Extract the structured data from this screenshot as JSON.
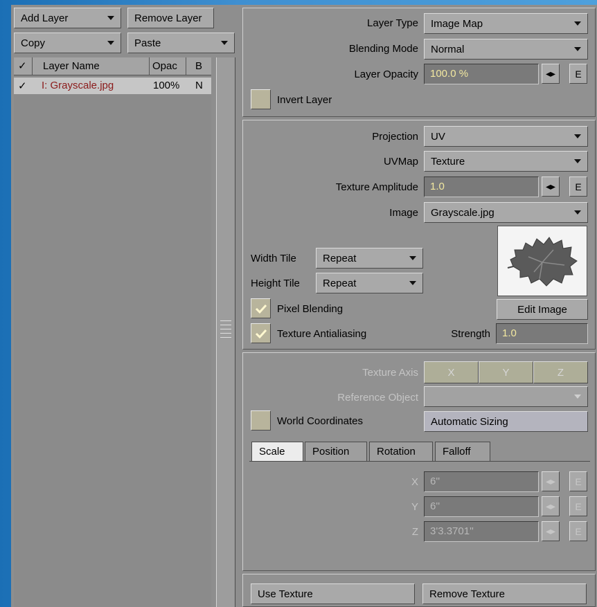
{
  "left_panel": {
    "add_layer": "Add Layer",
    "remove_layer": "Remove Layer",
    "copy": "Copy",
    "paste": "Paste",
    "columns": {
      "check": "✓",
      "name": "Layer Name",
      "opac": "Opac",
      "blend": "B"
    },
    "rows": [
      {
        "check": "✓",
        "name": "I: Grayscale.jpg",
        "opac": "100%",
        "blend": "N"
      }
    ]
  },
  "layer_section": {
    "layer_type_label": "Layer Type",
    "layer_type_value": "Image Map",
    "blending_mode_label": "Blending Mode",
    "blending_mode_value": "Normal",
    "layer_opacity_label": "Layer Opacity",
    "layer_opacity_value": "100.0 %",
    "envelope_label": "E",
    "invert_layer_label": "Invert Layer",
    "invert_layer_checked": false
  },
  "projection_section": {
    "projection_label": "Projection",
    "projection_value": "UV",
    "uvmap_label": "UVMap",
    "uvmap_value": "Texture",
    "texture_amplitude_label": "Texture Amplitude",
    "texture_amplitude_value": "1.0",
    "envelope_label": "E",
    "image_label": "Image",
    "image_value": "Grayscale.jpg",
    "width_tile_label": "Width Tile",
    "width_tile_value": "Repeat",
    "height_tile_label": "Height Tile",
    "height_tile_value": "Repeat",
    "pixel_blending_label": "Pixel Blending",
    "pixel_blending_checked": true,
    "texture_antialiasing_label": "Texture Antialiasing",
    "texture_antialiasing_checked": true,
    "edit_image_label": "Edit Image",
    "strength_label": "Strength",
    "strength_value": "1.0"
  },
  "axis_section": {
    "texture_axis_label": "Texture Axis",
    "axis_x": "X",
    "axis_y": "Y",
    "axis_z": "Z",
    "reference_object_label": "Reference Object",
    "reference_object_value": "",
    "world_coordinates_label": "World Coordinates",
    "world_coordinates_checked": false,
    "automatic_sizing_label": "Automatic Sizing",
    "tabs": [
      "Scale",
      "Position",
      "Rotation",
      "Falloff"
    ],
    "active_tab": "Scale",
    "scale": [
      {
        "axis": "X",
        "value": "6''"
      },
      {
        "axis": "Y",
        "value": "6''"
      },
      {
        "axis": "Z",
        "value": "3'3.3701''"
      }
    ],
    "envelope_label": "E"
  },
  "footer": {
    "use_texture": "Use Texture",
    "remove_texture": "Remove Texture"
  },
  "colors": {
    "panel": "#8e8e8e",
    "field_text": "#f2e8a0",
    "layer_name_text": "#8b1a1a",
    "background": "#3f8fd0"
  }
}
